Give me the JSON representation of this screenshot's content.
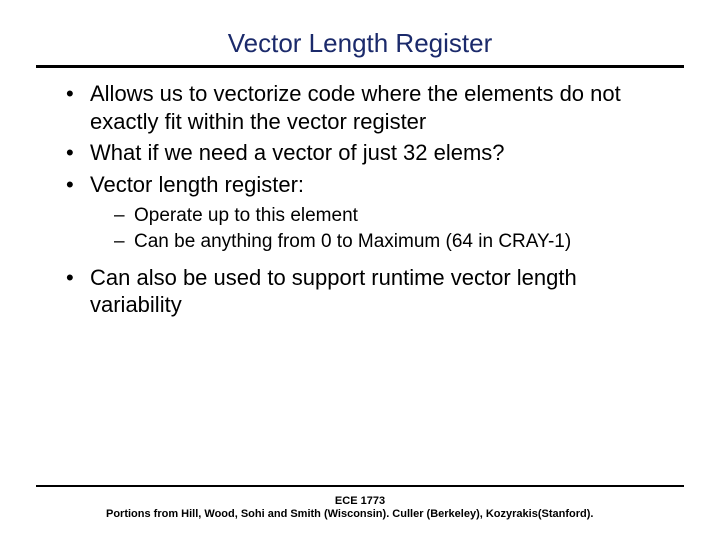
{
  "title": "Vector Length Register",
  "bullets": {
    "b1": "Allows us to vectorize code where the elements do not exactly fit within the vector register",
    "b2": "What if we need a vector of just 32 elems?",
    "b3": "Vector length register:",
    "b3_sub": {
      "s1": "Operate up to this element",
      "s2": "Can be anything from 0 to Maximum (64 in CRAY-1)"
    },
    "b4": "Can also be used to support runtime vector length variability"
  },
  "footer": {
    "course": "ECE 1773",
    "credits": "Portions from Hill, Wood, Sohi and Smith (Wisconsin). Culler (Berkeley), Kozyrakis(Stanford)."
  }
}
